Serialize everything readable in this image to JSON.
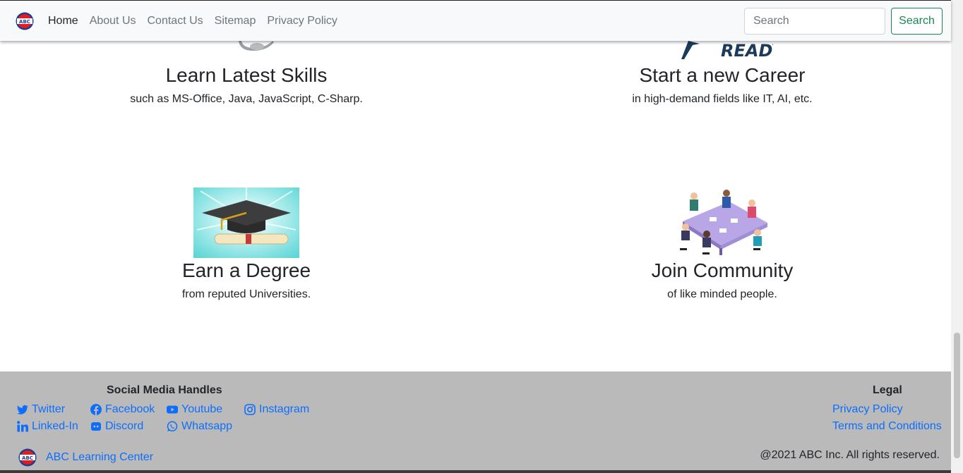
{
  "navbar": {
    "links": [
      "Home",
      "About Us",
      "Contact Us",
      "Sitemap",
      "Privacy Policy"
    ],
    "search_placeholder": "Search",
    "search_button": "Search"
  },
  "features": [
    {
      "title": "Learn Latest Skills",
      "desc": "such as MS-Office, Java, JavaScript, C-Sharp."
    },
    {
      "title": "Start a new Career",
      "desc": "in high-demand fields like IT, AI, etc."
    },
    {
      "title": "Earn a Degree",
      "desc": "from reputed Universities."
    },
    {
      "title": "Join Community",
      "desc": "of like minded people."
    }
  ],
  "partial_image_text": "READY",
  "footer": {
    "social_heading": "Social Media Handles",
    "legal_heading": "Legal",
    "social": [
      {
        "label": "Twitter",
        "icon": "twitter-icon"
      },
      {
        "label": "Facebook",
        "icon": "facebook-icon"
      },
      {
        "label": "Youtube",
        "icon": "youtube-icon"
      },
      {
        "label": "Instagram",
        "icon": "instagram-icon"
      },
      {
        "label": "Linked-In",
        "icon": "linkedin-icon"
      },
      {
        "label": "Discord",
        "icon": "discord-icon"
      },
      {
        "label": "Whatsapp",
        "icon": "whatsapp-icon"
      }
    ],
    "legal": [
      "Privacy Policy",
      "Terms and Conditions"
    ],
    "brand": "ABC Learning Center",
    "logo_text": "ABC",
    "copyright": "@2021 ABC Inc. All rights reserved."
  },
  "colors": {
    "link": "#0d6efd",
    "success": "#198754",
    "footer_bg": "#bababa"
  }
}
